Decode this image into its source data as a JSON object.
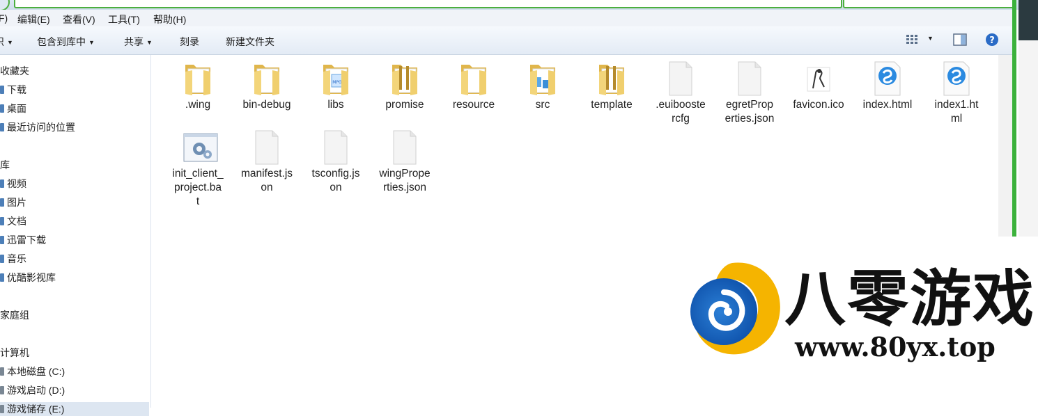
{
  "menubar": {
    "items": [
      "F)",
      "编辑(E)",
      "查看(V)",
      "工具(T)",
      "帮助(H)"
    ]
  },
  "toolbar": {
    "org_partial": "织",
    "include_library": "包含到库中",
    "share": "共享",
    "burn": "刻录",
    "new_folder": "新建文件夹",
    "icons": [
      "view-options-icon",
      "preview-pane-icon",
      "help-icon"
    ]
  },
  "nav": {
    "favorites_header": "收藏夹",
    "favorites": [
      "下载",
      "桌面",
      "最近访问的位置"
    ],
    "libraries_header": "库",
    "libraries": [
      "视频",
      "图片",
      "文档",
      "迅雷下载",
      "音乐",
      "优酷影视库"
    ],
    "homegroup": "家庭组",
    "computer_header": "计算机",
    "drives": [
      "本地磁盘 (C:)",
      "游戏启动 (D:)",
      "游戏储存 (E:)"
    ]
  },
  "files": [
    {
      "name": ".wing",
      "type": "folder"
    },
    {
      "name": "bin-debug",
      "type": "folder"
    },
    {
      "name": "libs",
      "type": "folder-media"
    },
    {
      "name": "promise",
      "type": "folder-docs"
    },
    {
      "name": "resource",
      "type": "folder"
    },
    {
      "name": "src",
      "type": "folder-blue"
    },
    {
      "name": "template",
      "type": "folder-docs"
    },
    {
      "name": ".euibooste rcfg",
      "type": "file"
    },
    {
      "name": "egretProp erties.json",
      "type": "file"
    },
    {
      "name": "favicon.ico",
      "type": "ico"
    },
    {
      "name": "index.html",
      "type": "html"
    },
    {
      "name": "index1.ht ml",
      "type": "html"
    },
    {
      "name": "init_client_ project.ba t",
      "type": "bat"
    },
    {
      "name": "manifest.js on",
      "type": "file"
    },
    {
      "name": "tsconfig.js on",
      "type": "file"
    },
    {
      "name": "wingPrope rties.json",
      "type": "file"
    }
  ],
  "watermark": {
    "brand": "八零游戏",
    "url": "www.80yx.top"
  },
  "colors": {
    "accent_green": "#3cb23c",
    "folder_yellow": "#f3d57a",
    "nav_icon_blue": "#4d7fb8"
  }
}
